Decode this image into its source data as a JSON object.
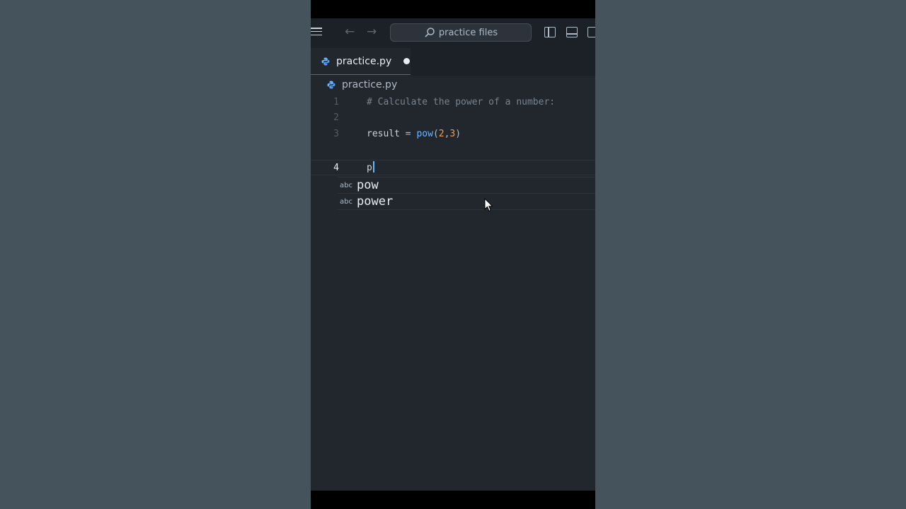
{
  "titlebar": {
    "search_text": "practice files"
  },
  "tabs": [
    {
      "label": "practice.py",
      "dirty": true
    }
  ],
  "breadcrumb": {
    "file": "practice.py"
  },
  "editor": {
    "lines": [
      {
        "number": "1",
        "text": "# Calculate the power of a number:"
      },
      {
        "number": "2",
        "text": ""
      },
      {
        "number": "3",
        "var": "result",
        "eq": " = ",
        "fn": "pow",
        "open": "(",
        "a": "2",
        "comma": ",",
        "b": "3",
        "close": ")"
      },
      {
        "number": "4",
        "text": "p"
      }
    ]
  },
  "suggestions": [
    {
      "kind": "abc",
      "label": "pow"
    },
    {
      "kind": "abc",
      "label": "power"
    }
  ],
  "colors": {
    "accent": "#316dca",
    "editor_bg": "#22272e",
    "page_bg": "#45535c"
  },
  "icons": [
    "menu-icon",
    "back-arrow-icon",
    "forward-arrow-icon",
    "search-icon",
    "python-file-icon",
    "layout-sidebar-icon",
    "layout-panel-icon",
    "layout-secondary-icon",
    "mouse-pointer-icon"
  ]
}
